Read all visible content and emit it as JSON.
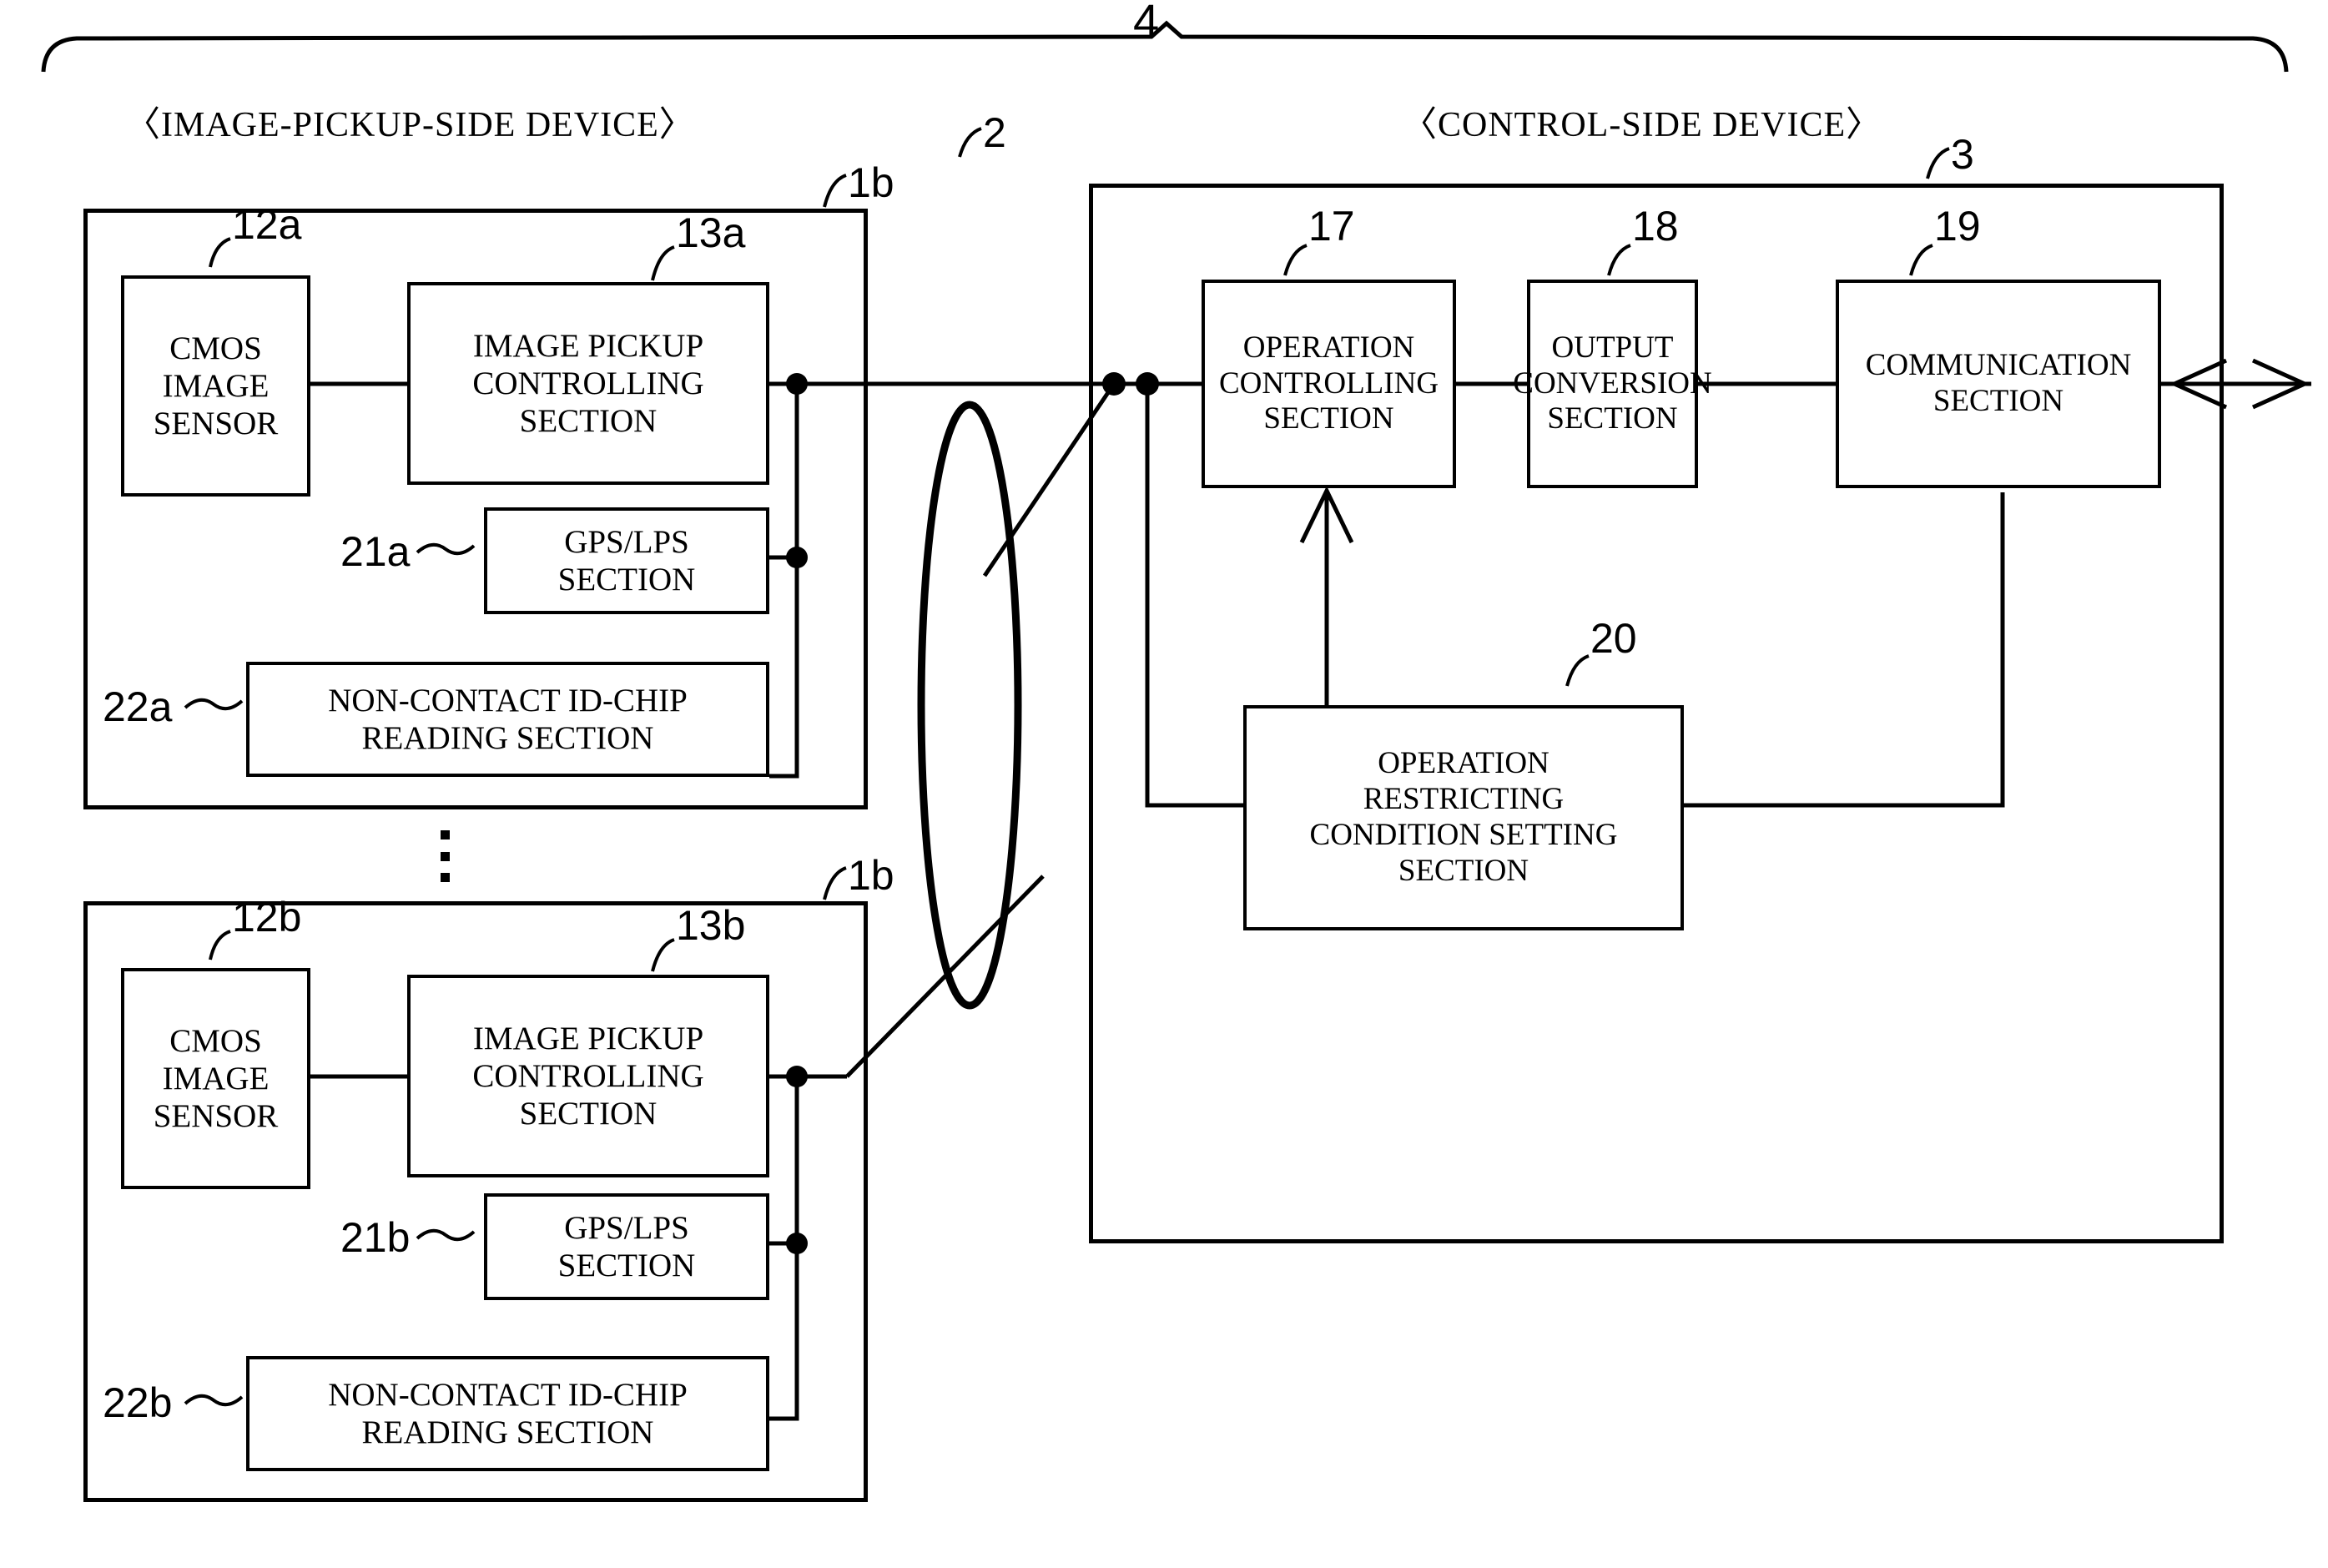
{
  "figure": {
    "system_ref": "4",
    "headers": {
      "left": "〈IMAGE-PICKUP-SIDE DEVICE〉",
      "right": "〈CONTROL-SIDE DEVICE〉"
    },
    "network_ref": "2",
    "control_device_ref": "3"
  },
  "pickup_device_a": {
    "ref": "1b",
    "blocks": [
      {
        "ref": "12a",
        "label": "CMOS\nIMAGE\nSENSOR"
      },
      {
        "ref": "13a",
        "label": "IMAGE PICKUP\nCONTROLLING\nSECTION"
      },
      {
        "ref": "21a",
        "label": "GPS/LPS\nSECTION"
      },
      {
        "ref": "22a",
        "label": "NON-CONTACT ID-CHIP\nREADING SECTION"
      }
    ]
  },
  "pickup_device_b": {
    "ref": "1b",
    "blocks": [
      {
        "ref": "12b",
        "label": "CMOS\nIMAGE\nSENSOR"
      },
      {
        "ref": "13b",
        "label": "IMAGE PICKUP\nCONTROLLING\nSECTION"
      },
      {
        "ref": "21b",
        "label": "GPS/LPS\nSECTION"
      },
      {
        "ref": "22b",
        "label": "NON-CONTACT ID-CHIP\nREADING SECTION"
      }
    ]
  },
  "control_device": {
    "ref": "3",
    "blocks": [
      {
        "ref": "17",
        "label": "OPERATION\nCONTROLLING\nSECTION"
      },
      {
        "ref": "18",
        "label": "OUTPUT\nCONVERSION\nSECTION"
      },
      {
        "ref": "19",
        "label": "COMMUNICATION\nSECTION"
      },
      {
        "ref": "20",
        "label": "OPERATION\nRESTRICTING\nCONDITION SETTING\nSECTION"
      }
    ]
  },
  "ellipsis": "⋮",
  "colors": {
    "ink": "#000000",
    "paper": "#ffffff"
  }
}
